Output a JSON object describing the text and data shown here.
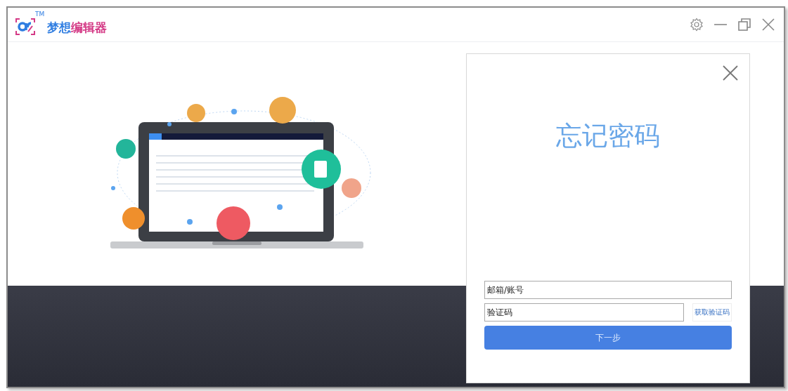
{
  "window": {
    "logo_mark": "TM",
    "title_part1": "梦想",
    "title_part2": "编辑器"
  },
  "dialog": {
    "title": "忘记密码",
    "account_field": {
      "placeholder": "邮箱/账号"
    },
    "code_field": {
      "placeholder": "验证码"
    },
    "get_code_button": "获取验证码",
    "next_button": "下一步"
  }
}
